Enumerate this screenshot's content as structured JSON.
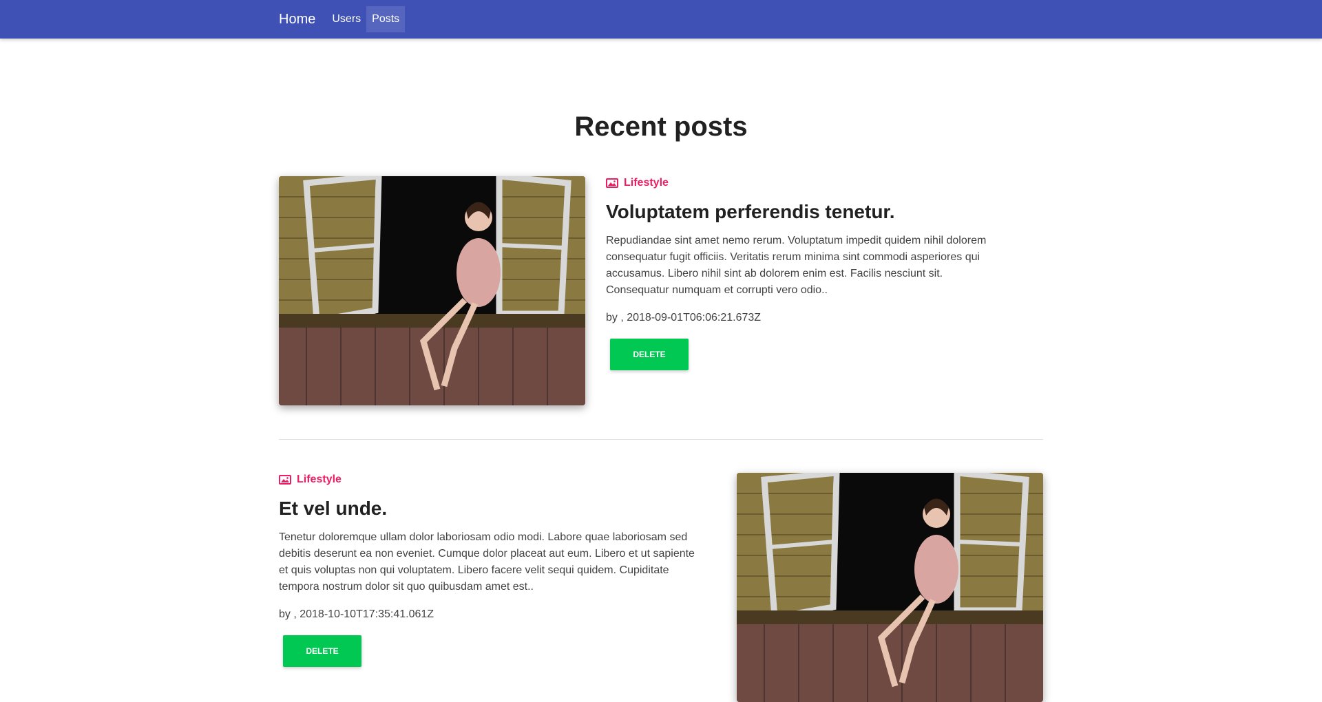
{
  "nav": {
    "brand": "Home",
    "links": [
      {
        "label": "Users",
        "active": false
      },
      {
        "label": "Posts",
        "active": true
      }
    ],
    "color": "#3f51b5"
  },
  "page": {
    "title": "Recent posts"
  },
  "posts": [
    {
      "category": "Lifestyle",
      "category_icon": "image-icon",
      "title": "Voluptatem perferendis tenetur.",
      "excerpt": "Repudiandae sint amet nemo rerum. Voluptatum impedit quidem nihil dolorem consequatur fugit officiis. Veritatis rerum minima sint commodi asperiores qui accusamus. Libero nihil sint ab dolorem enim est. Facilis nesciunt sit. Consequatur numquam et corrupti vero odio..",
      "meta": "by , 2018-09-01T06:06:21.673Z",
      "delete_label": "DELETE"
    },
    {
      "category": "Lifestyle",
      "category_icon": "image-icon",
      "title": "Et vel unde.",
      "excerpt": "Tenetur doloremque ullam dolor laboriosam odio modi. Labore quae laboriosam sed debitis deserunt ea non eveniet. Cumque dolor placeat aut eum. Libero et ut sapiente et quis voluptas non qui voluptatem. Libero facere velit sequi quidem. Cupiditate tempora nostrum dolor sit quo quibusdam amet est..",
      "meta": "by , 2018-10-10T17:35:41.061Z",
      "delete_label": "DELETE"
    }
  ],
  "colors": {
    "accent": "#e91e63",
    "delete": "#00c853"
  }
}
